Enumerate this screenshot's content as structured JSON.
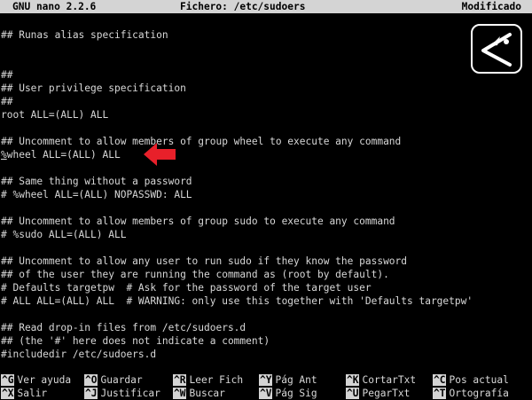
{
  "titlebar": {
    "version": "GNU nano 2.2.6",
    "file": "Fichero: /etc/sudoers",
    "status": "Modificado"
  },
  "editor": {
    "lines": [
      "## Runas alias specification",
      "",
      "",
      "##",
      "## User privilege specification",
      "##",
      "root ALL=(ALL) ALL",
      "",
      "## Uncomment to allow members of group wheel to execute any command",
      "wheel ALL=(ALL) ALL",
      "",
      "## Same thing without a password",
      "# %wheel ALL=(ALL) NOPASSWD: ALL",
      "",
      "## Uncomment to allow members of group sudo to execute any command",
      "# %sudo ALL=(ALL) ALL",
      "",
      "## Uncomment to allow any user to run sudo if they know the password",
      "## of the user they are running the command as (root by default).",
      "# Defaults targetpw  # Ask for the password of the target user",
      "# ALL ALL=(ALL) ALL  # WARNING: only use this together with 'Defaults targetpw'",
      "",
      "## Read drop-in files from /etc/sudoers.d",
      "## (the '#' here does not indicate a comment)",
      "#includedir /etc/sudoers.d"
    ],
    "cursor_line_prefix": "%"
  },
  "shortcuts": [
    {
      "key": "^G",
      "label": "Ver ayuda"
    },
    {
      "key": "^O",
      "label": "Guardar"
    },
    {
      "key": "^R",
      "label": "Leer Fich"
    },
    {
      "key": "^Y",
      "label": "Pág Ant"
    },
    {
      "key": "^K",
      "label": "CortarTxt"
    },
    {
      "key": "^C",
      "label": "Pos actual"
    },
    {
      "key": "^X",
      "label": "Salir"
    },
    {
      "key": "^J",
      "label": "Justificar"
    },
    {
      "key": "^W",
      "label": "Buscar"
    },
    {
      "key": "^V",
      "label": "Pág Sig"
    },
    {
      "key": "^U",
      "label": "PegarTxt"
    },
    {
      "key": "^T",
      "label": "Ortografía"
    }
  ],
  "colors": {
    "arrow": "#e8202a",
    "bar": "#d4d4d4",
    "text": "#d8d8d8",
    "background": "#000000"
  },
  "icons": {
    "logo": "share-logo-icon",
    "arrow": "arrow-left-icon"
  }
}
